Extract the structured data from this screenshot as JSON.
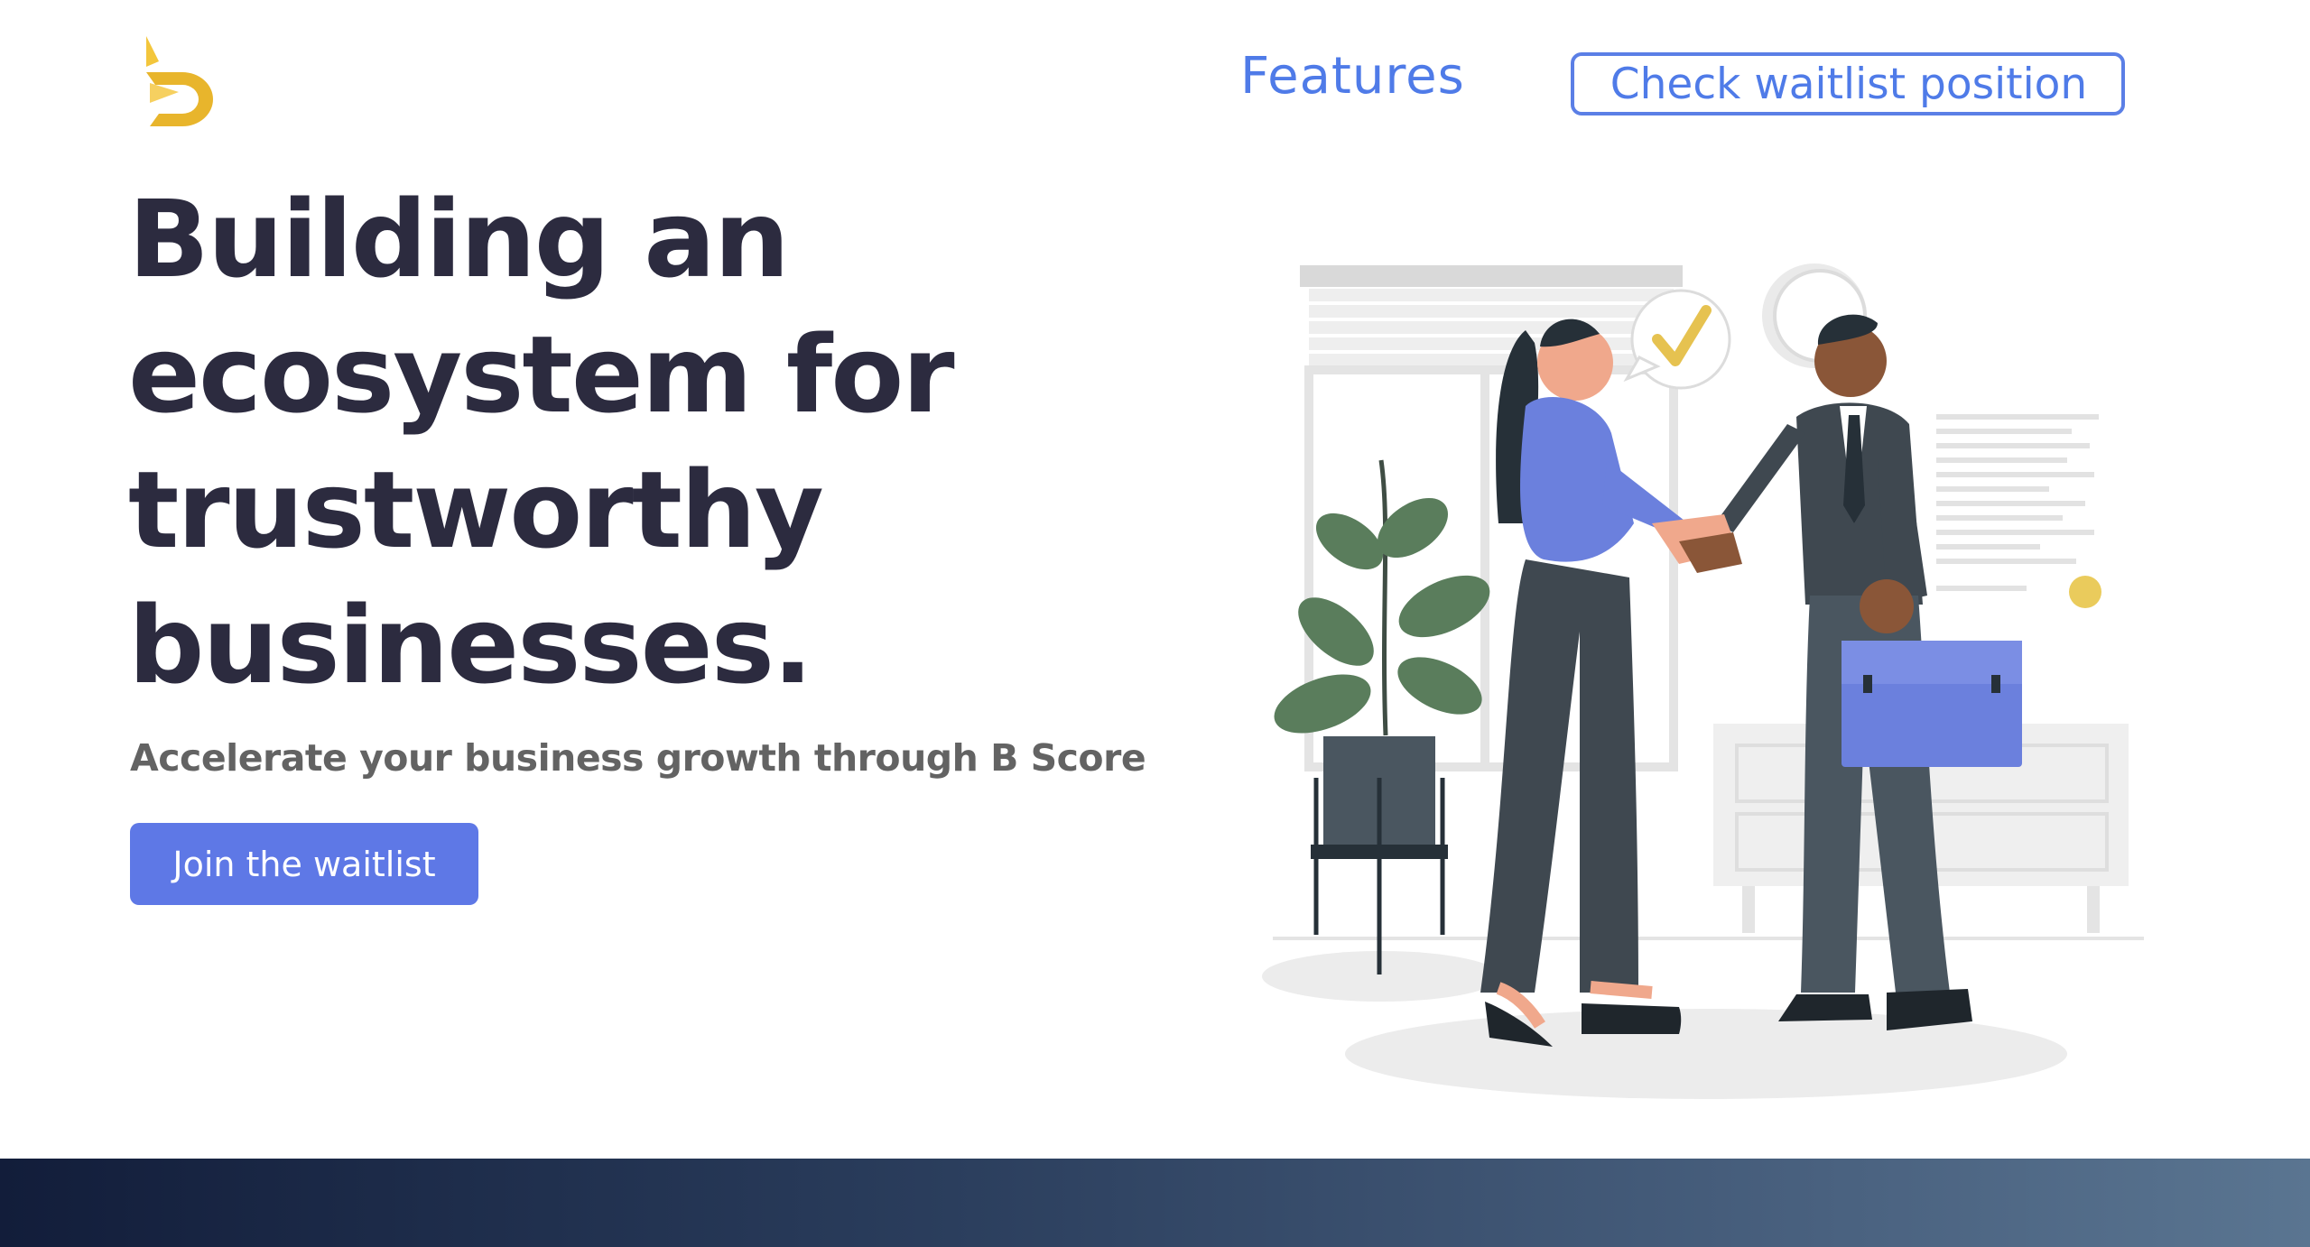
{
  "header": {
    "logo_icon": "b-arrow-logo-icon",
    "nav_features": "Features",
    "check_waitlist": "Check waitlist position"
  },
  "hero": {
    "title_lines": [
      "Building an",
      "ecosystem for",
      "trustworthy",
      "businesses."
    ],
    "subtitle": "Accelerate your business growth through B Score",
    "cta": "Join the waitlist"
  },
  "illustration": {
    "icon": "business-handshake-illustration",
    "check_icon": "checkmark-speech-bubble-icon"
  },
  "colors": {
    "accent": "#5e78e6",
    "link": "#4f7be8",
    "title": "#2c2b3f",
    "logo": "#f1c232",
    "footer_start": "#121d3a",
    "footer_end": "#5a7591"
  }
}
